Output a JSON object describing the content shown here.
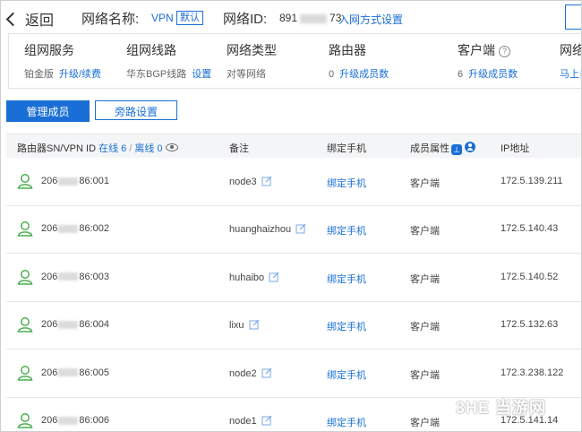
{
  "header": {
    "back_label": "返回",
    "network_name_label": "网络名称:",
    "network_name_value": "VPN",
    "default_badge": "默认",
    "network_id_label": "网络ID:",
    "network_id_prefix": "891",
    "network_id_suffix": "73",
    "join_method_link": "入网方式设置"
  },
  "summary": {
    "service": {
      "title": "组网服务",
      "value": "铂金版",
      "link": "升级/续费"
    },
    "line": {
      "title": "组网线路",
      "value": "华东BGP线路",
      "link": "设置"
    },
    "type": {
      "title": "网络类型",
      "value": "对等网络"
    },
    "router": {
      "title": "路由器",
      "value": "0",
      "link": "升级成员数"
    },
    "client": {
      "title": "客户端",
      "value": "6",
      "link": "升级成员数"
    },
    "more": {
      "title": "网络",
      "link": "马上自"
    }
  },
  "buttons": {
    "manage_members": "管理成员",
    "bypass_settings": "旁路设置"
  },
  "table": {
    "headers": {
      "sn": "路由器SN/VPN ID",
      "online": "在线 6",
      "separator": "/",
      "offline": "离线 0",
      "note": "备注",
      "phone": "绑定手机",
      "attr": "成员属性",
      "ip": "IP地址"
    },
    "rows": [
      {
        "sn_prefix": "206",
        "sn_suffix": "86:001",
        "note": "node3",
        "phone": "绑定手机",
        "attr": "客户端",
        "ip": "172.5.139.211"
      },
      {
        "sn_prefix": "206",
        "sn_suffix": "86:002",
        "note": "huanghaizhou",
        "phone": "绑定手机",
        "attr": "客户端",
        "ip": "172.5.140.43"
      },
      {
        "sn_prefix": "206",
        "sn_suffix": "86:003",
        "note": "huhaibo",
        "phone": "绑定手机",
        "attr": "客户端",
        "ip": "172.5.140.52"
      },
      {
        "sn_prefix": "206",
        "sn_suffix": "86:004",
        "note": "lixu",
        "phone": "绑定手机",
        "attr": "客户端",
        "ip": "172.5.132.63"
      },
      {
        "sn_prefix": "206",
        "sn_suffix": "86:005",
        "note": "node2",
        "phone": "绑定手机",
        "attr": "客户端",
        "ip": "172.3.238.122"
      },
      {
        "sn_prefix": "206",
        "sn_suffix": "86:006",
        "note": "node1",
        "phone": "绑定手机",
        "attr": "客户端",
        "ip": "172.5.141.14"
      }
    ]
  },
  "watermark": "3HE 当游网",
  "colors": {
    "accent": "#1a6fd6",
    "user_icon": "#4caf50"
  }
}
